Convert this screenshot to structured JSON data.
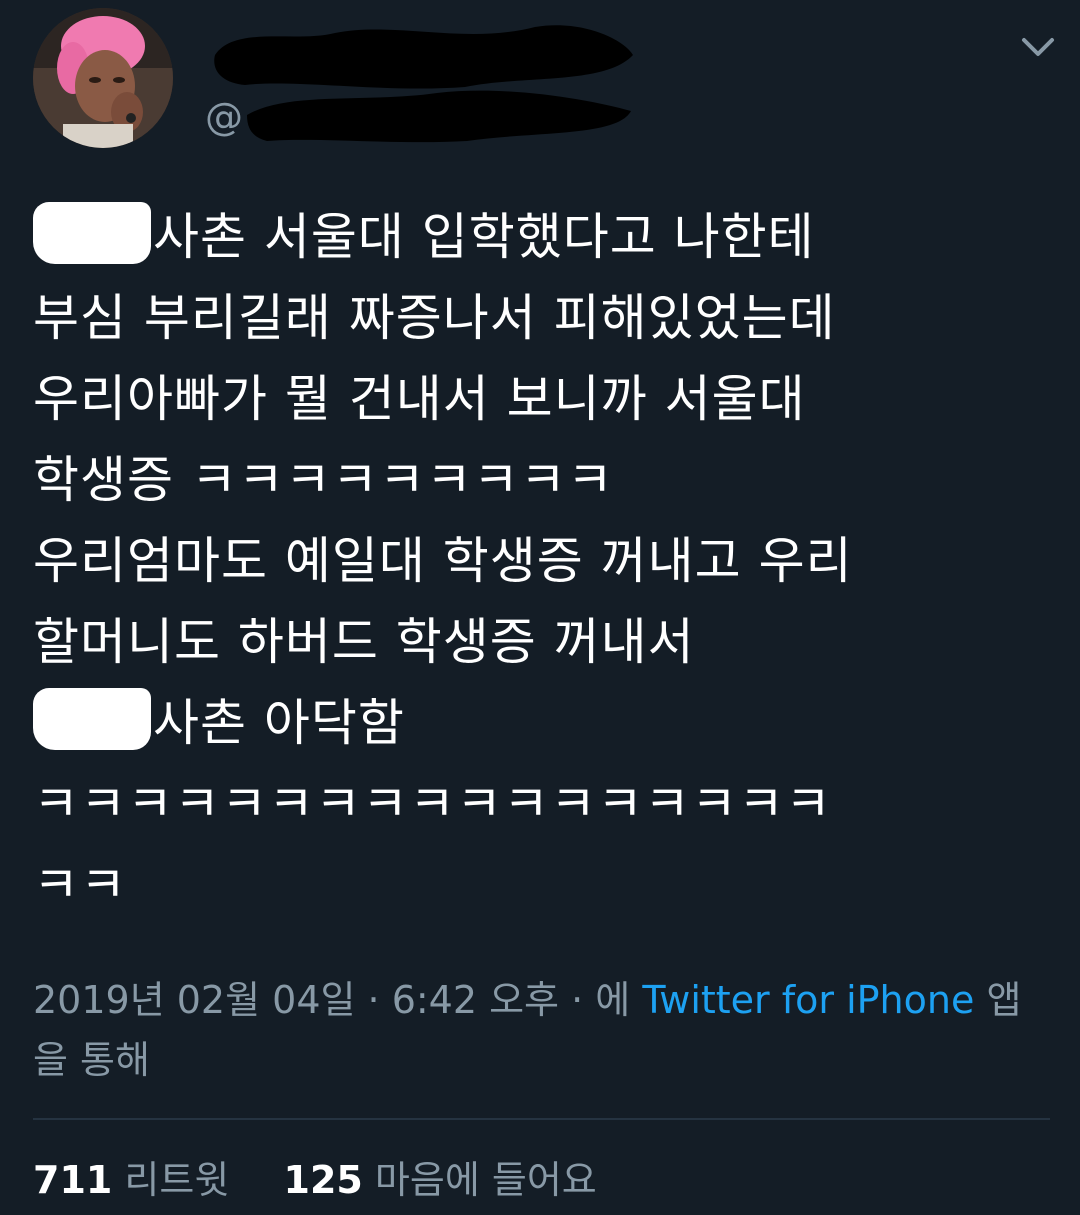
{
  "header": {
    "handle_prefix": "@",
    "icons": {
      "avatar": "profile-avatar",
      "menu": "chevron-down-icon"
    }
  },
  "tweet": {
    "lines": [
      "사촌 서울대 입학했다고 나한테",
      "부심 부리길래 짜증나서 피해있었는데",
      "우리아빠가 뭘 건내서 보니까 서울대",
      "학생증 ㅋㅋㅋㅋㅋㅋㅋㅋㅋ",
      "우리엄마도 예일대 학생증 꺼내고 우리",
      "할머니도 하버드 학생증 꺼내서",
      "사촌 아닥함",
      "ㅋㅋㅋㅋㅋㅋㅋㅋㅋㅋㅋㅋㅋㅋㅋㅋㅋ",
      "ㅋㅋ"
    ]
  },
  "meta": {
    "datetime": "2019년 02월 04일 · 6:42 오후 · 에 ",
    "source_link": "Twitter for iPhone",
    "suffix": " 앱을 통해"
  },
  "stats": {
    "retweets_count": "711",
    "retweets_label": "리트윗",
    "likes_count": "125",
    "likes_label": "마음에 들어요"
  },
  "colors": {
    "background": "#141d26",
    "text": "#ffffff",
    "secondary": "#8899a6",
    "link": "#1da1f2"
  }
}
